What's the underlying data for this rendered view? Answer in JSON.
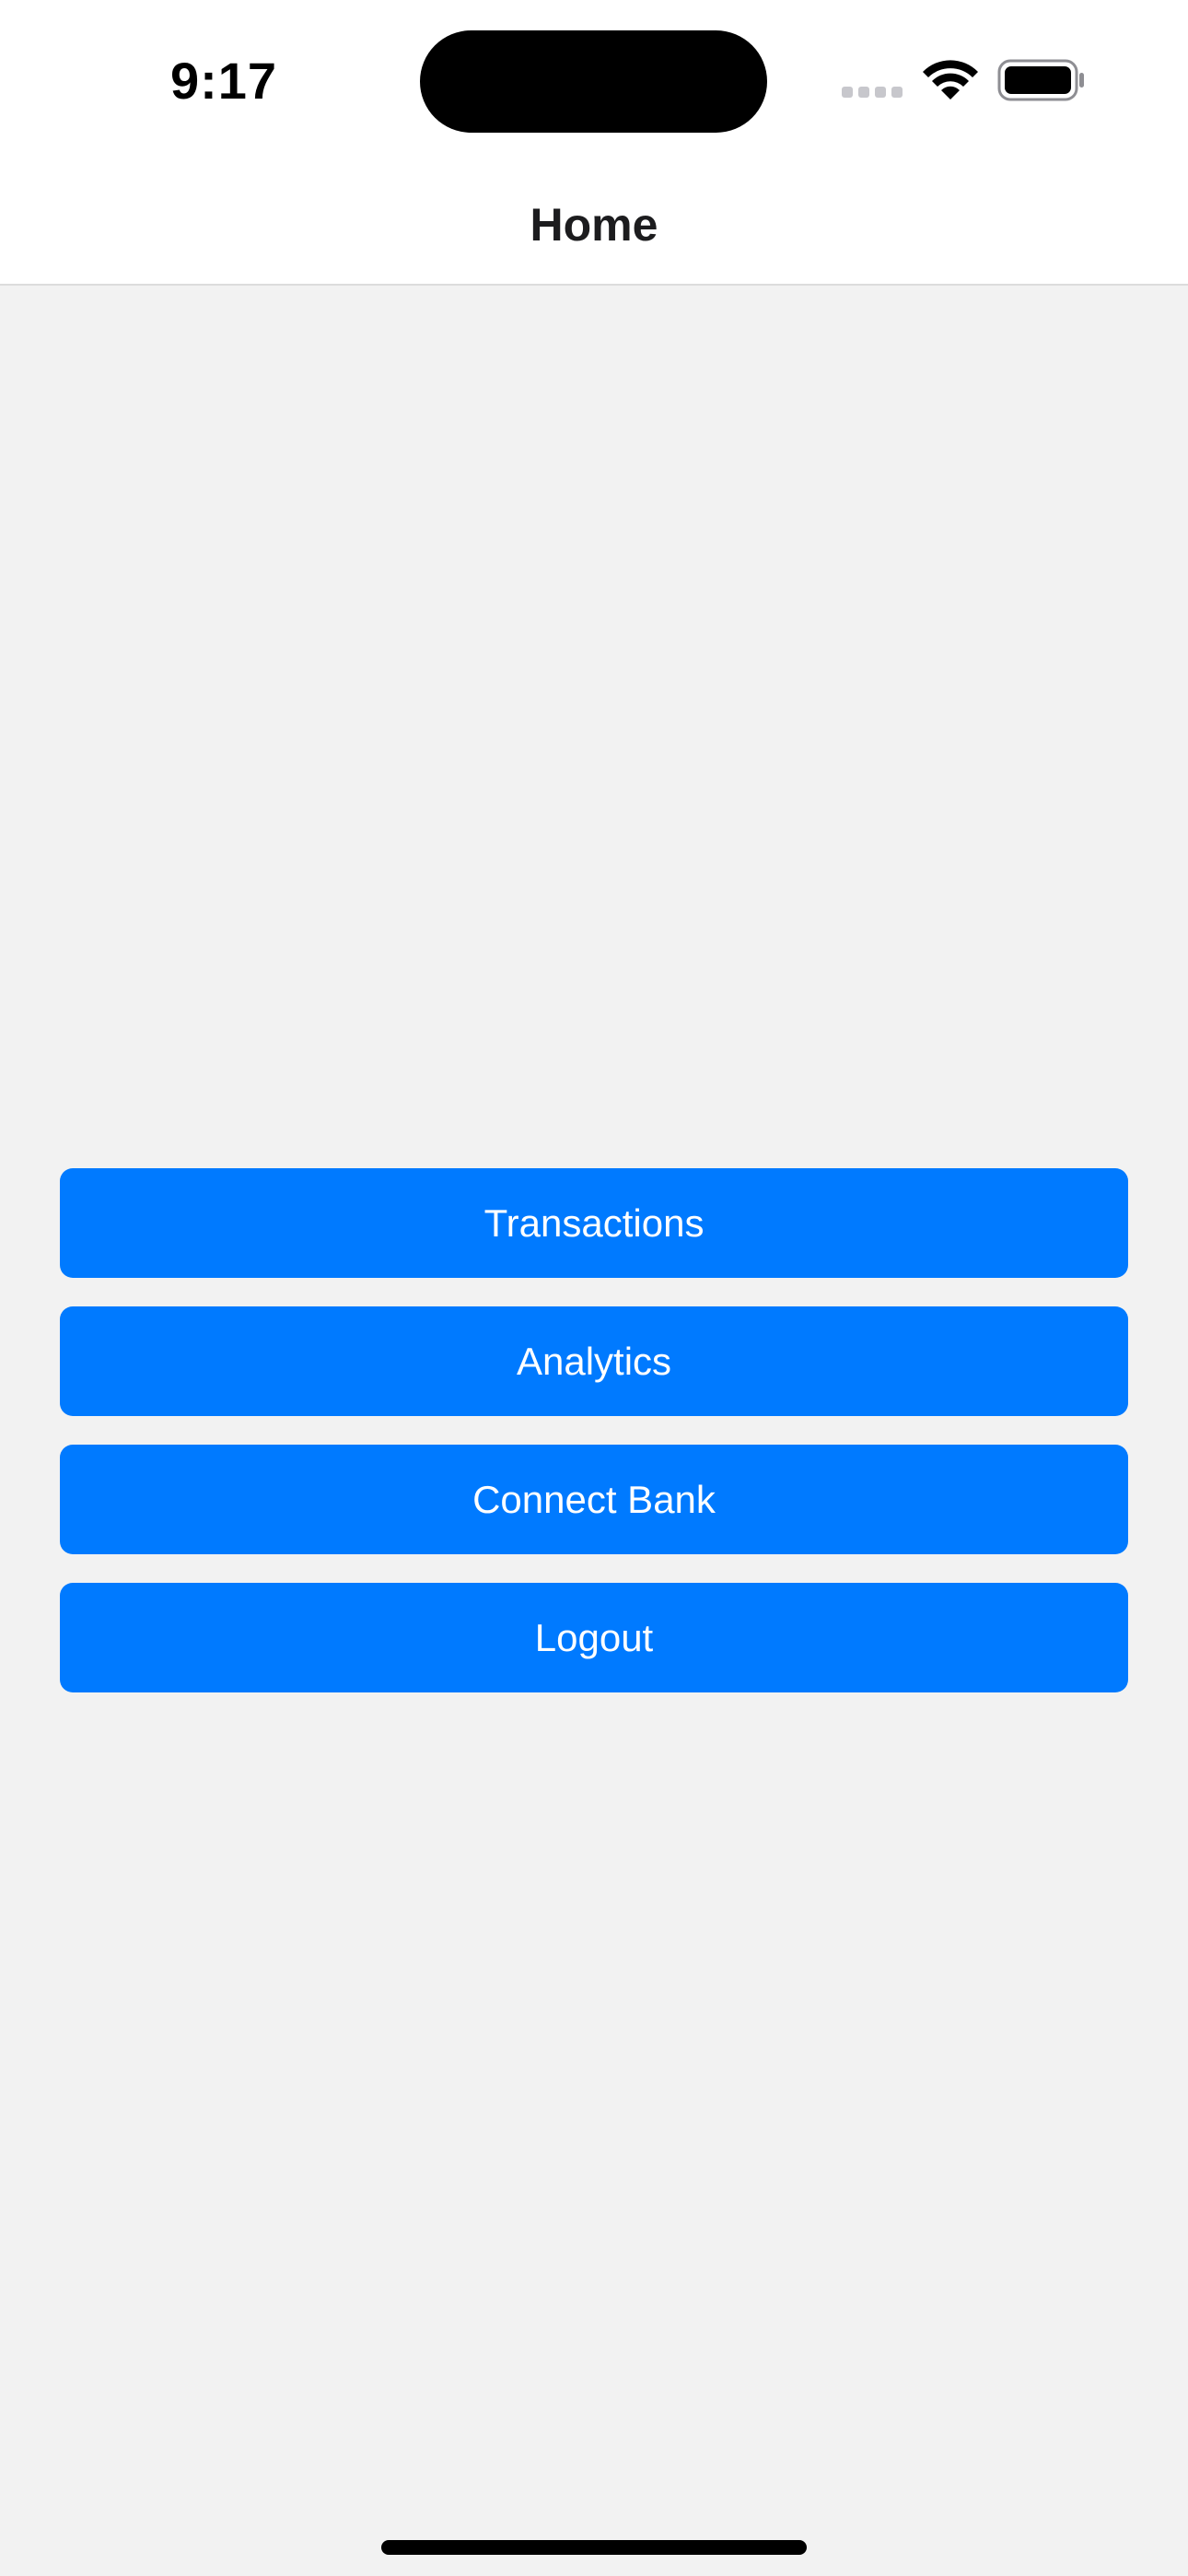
{
  "status_bar": {
    "time": "9:17",
    "signal_icon": "cellular-signal-icon",
    "wifi_icon": "wifi-icon",
    "battery_icon": "battery-icon"
  },
  "nav": {
    "title": "Home"
  },
  "buttons": [
    {
      "label": "Transactions"
    },
    {
      "label": "Analytics"
    },
    {
      "label": "Connect Bank"
    },
    {
      "label": "Logout"
    }
  ],
  "colors": {
    "accent": "#007aff",
    "background": "#f2f2f2",
    "nav_background": "#ffffff",
    "button_text": "#ffffff"
  }
}
